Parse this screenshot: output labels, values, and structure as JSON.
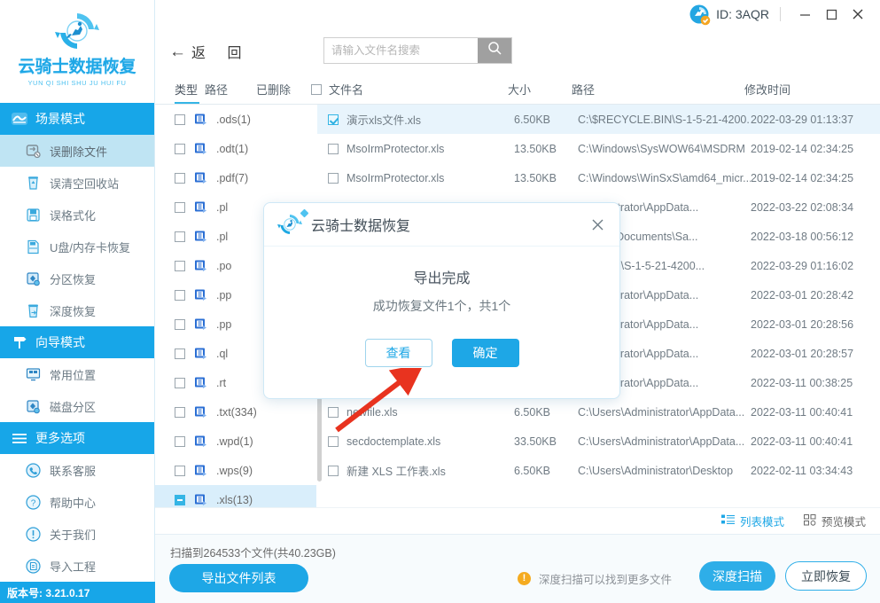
{
  "app": {
    "brand_title": "云骑士数据恢复",
    "brand_subtitle": "YUN QI SHI SHU JU HUI FU",
    "version_label": "版本号: 3.21.0.17",
    "accent_color": "#1ea7e6",
    "header_color": "#17a6e8",
    "selected_row_color": "#e8f4fc"
  },
  "titlebar": {
    "user_id": "ID: 3AQR",
    "minimize_icon": "minimize-icon",
    "maximize_icon": "maximize-icon",
    "close_icon": "close-icon"
  },
  "sidebar": {
    "groups": [
      {
        "label": "场景模式",
        "icon": "scene-mode-icon",
        "items": [
          {
            "label": "误删除文件",
            "icon": "deleted-file-icon",
            "active": true
          },
          {
            "label": "误清空回收站",
            "icon": "recycle-bin-icon",
            "active": false
          },
          {
            "label": "误格式化",
            "icon": "format-disk-icon",
            "active": false
          },
          {
            "label": "U盘/内存卡恢复",
            "icon": "usb-card-icon",
            "active": false
          },
          {
            "label": "分区恢复",
            "icon": "partition-recover-icon",
            "active": false
          },
          {
            "label": "深度恢复",
            "icon": "deep-recover-icon",
            "active": false
          }
        ]
      },
      {
        "label": "向导模式",
        "icon": "wizard-mode-icon",
        "items": [
          {
            "label": "常用位置",
            "icon": "common-location-icon",
            "active": false
          },
          {
            "label": "磁盘分区",
            "icon": "disk-partition-icon",
            "active": false
          }
        ]
      },
      {
        "label": "更多选项",
        "icon": "hamburger-icon",
        "items": [
          {
            "label": "联系客服",
            "icon": "phone-support-icon",
            "active": false
          },
          {
            "label": "帮助中心",
            "icon": "help-center-icon",
            "active": false
          },
          {
            "label": "关于我们",
            "icon": "about-us-icon",
            "active": false
          },
          {
            "label": "导入工程",
            "icon": "import-project-icon",
            "active": false
          }
        ]
      }
    ]
  },
  "toolbar": {
    "back_label": "返 回",
    "back_icon": "arrow-left-icon",
    "search_placeholder": "请输入文件名搜索",
    "search_value": "",
    "search_icon": "search-icon"
  },
  "table": {
    "headers": {
      "type": "类型",
      "path_tree": "路径",
      "deleted": "已删除",
      "filename": "文件名",
      "size": "大小",
      "path": "路径",
      "mtime": "修改时间"
    }
  },
  "tree": {
    "items": [
      {
        "label": ".ods(1)",
        "state": "unchecked",
        "selected": false
      },
      {
        "label": ".odt(1)",
        "state": "unchecked",
        "selected": false
      },
      {
        "label": ".pdf(7)",
        "state": "unchecked",
        "selected": false
      },
      {
        "label": ".pl",
        "state": "unchecked",
        "selected": false
      },
      {
        "label": ".pl",
        "state": "unchecked",
        "selected": false
      },
      {
        "label": ".po",
        "state": "unchecked",
        "selected": false
      },
      {
        "label": ".pp",
        "state": "unchecked",
        "selected": false
      },
      {
        "label": ".pp",
        "state": "unchecked",
        "selected": false
      },
      {
        "label": ".ql",
        "state": "unchecked",
        "selected": false
      },
      {
        "label": ".rt",
        "state": "unchecked",
        "selected": false
      },
      {
        "label": ".txt(334)",
        "state": "unchecked",
        "selected": false
      },
      {
        "label": ".wpd(1)",
        "state": "unchecked",
        "selected": false
      },
      {
        "label": ".wps(9)",
        "state": "unchecked",
        "selected": false
      },
      {
        "label": ".xls(13)",
        "state": "indeterminate",
        "selected": true
      }
    ]
  },
  "files": {
    "rows": [
      {
        "name": "演示xls文件.xls",
        "size": "6.50KB",
        "path": "C:\\$RECYCLE.BIN\\S-1-5-21-4200...",
        "mtime": "2022-03-29 01:13:37",
        "checked": true,
        "selected": true
      },
      {
        "name": "MsoIrmProtector.xls",
        "size": "13.50KB",
        "path": "C:\\Windows\\SysWOW64\\MSDRM",
        "mtime": "2019-02-14 02:34:25",
        "checked": false,
        "selected": false
      },
      {
        "name": "MsoIrmProtector.xls",
        "size": "13.50KB",
        "path": "C:\\Windows\\WinSxS\\amd64_micr...",
        "mtime": "2019-02-14 02:34:25",
        "checked": false,
        "selected": false
      },
      {
        "name": "",
        "size": "",
        "path": "Administrator\\AppData...",
        "mtime": "2022-03-22 02:08:34",
        "checked": false,
        "selected": false
      },
      {
        "name": "",
        "size": "",
        "path": "Default\\Documents\\Sa...",
        "mtime": "2022-03-18 00:56:12",
        "checked": false,
        "selected": false
      },
      {
        "name": "",
        "size": "",
        "path": "CLE.BIN\\S-1-5-21-4200...",
        "mtime": "2022-03-29 01:16:02",
        "checked": false,
        "selected": false
      },
      {
        "name": "",
        "size": "",
        "path": "Administrator\\AppData...",
        "mtime": "2022-03-01 20:28:42",
        "checked": false,
        "selected": false
      },
      {
        "name": "",
        "size": "",
        "path": "Administrator\\AppData...",
        "mtime": "2022-03-01 20:28:56",
        "checked": false,
        "selected": false
      },
      {
        "name": "",
        "size": "",
        "path": "Administrator\\AppData...",
        "mtime": "2022-03-01 20:28:57",
        "checked": false,
        "selected": false
      },
      {
        "name": "",
        "size": "",
        "path": "Administrator\\AppData...",
        "mtime": "2022-03-11 00:38:25",
        "checked": false,
        "selected": false
      },
      {
        "name": "newfile.xls",
        "size": "6.50KB",
        "path": "C:\\Users\\Administrator\\AppData...",
        "mtime": "2022-03-11 00:40:41",
        "checked": false,
        "selected": false
      },
      {
        "name": "secdoctemplate.xls",
        "size": "33.50KB",
        "path": "C:\\Users\\Administrator\\AppData...",
        "mtime": "2022-03-11 00:40:41",
        "checked": false,
        "selected": false
      },
      {
        "name": "新建 XLS 工作表.xls",
        "size": "6.50KB",
        "path": "C:\\Users\\Administrator\\Desktop",
        "mtime": "2022-02-11 03:34:43",
        "checked": false,
        "selected": false
      }
    ]
  },
  "viewmodes": {
    "list_label": "列表模式",
    "list_icon": "list-view-icon",
    "preview_label": "预览模式",
    "preview_icon": "grid-view-icon"
  },
  "bottom": {
    "scan_status": "扫描到264533个文件(共40.23GB)",
    "export_label": "导出文件列表",
    "hint_icon": "warning-icon",
    "hint_text": "深度扫描可以找到更多文件",
    "deep_scan_label": "深度扫描",
    "recover_now_label": "立即恢复"
  },
  "modal": {
    "title": "云骑士数据恢复",
    "logo_icon": "app-logo-icon",
    "close_icon": "close-icon",
    "main_text": "导出完成",
    "sub_text": "成功恢复文件1个，共1个",
    "view_label": "查看",
    "ok_label": "确定"
  }
}
